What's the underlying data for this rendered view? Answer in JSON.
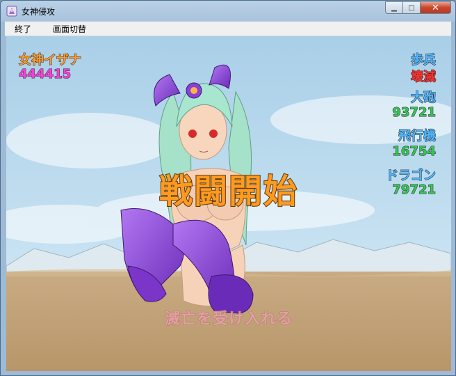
{
  "window": {
    "title": "女神侵攻"
  },
  "controls": {
    "minimize": "▁",
    "maximize": "□",
    "close": "✕"
  },
  "menu": [
    {
      "label": "終了"
    },
    {
      "label": "画面切替"
    }
  ],
  "hud": {
    "goddess_name": "女神イザナ",
    "goddess_hp": "444415",
    "enemies": [
      {
        "label": "歩兵",
        "value": "壊滅",
        "value_color": "#ff3030"
      },
      {
        "label": "大砲",
        "value": "93721",
        "value_color": "#37c455"
      },
      {
        "label": "飛行機",
        "value": "16754",
        "value_color": "#37c455"
      },
      {
        "label": "ドラゴン",
        "value": "79721",
        "value_color": "#37c455"
      }
    ]
  },
  "banner": "戦闘開始",
  "subtitle": "滅亡を受け入れる",
  "colors": {
    "sky": "#bcdcf0",
    "ground": "#c2a27a",
    "armor": "#8a3fd6",
    "hair": "#a9e6cf"
  }
}
